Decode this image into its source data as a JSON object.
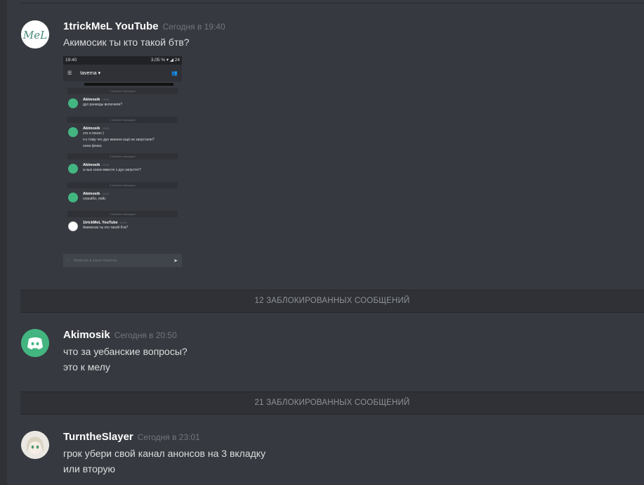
{
  "messages": [
    {
      "author": "1trickMeL YouTube",
      "timestamp": "Сегодня в 19:40",
      "avatar_text": "MeL",
      "lines": [
        "Акимосик ты кто такой бтв?"
      ]
    },
    {
      "author": "Akimosik",
      "timestamp": "Сегодня в 20:50",
      "lines": [
        "что за уебанские вопросы?",
        "это к мелу"
      ]
    },
    {
      "author": "TurntheSlayer",
      "timestamp": "Сегодня в 23:01",
      "lines": [
        "грок убери свой канал анонсов на 3 вкладку",
        "или вторую"
      ]
    }
  ],
  "blocked": [
    "12 ЗАБЛОКИРОВАННЫХ СООБЩЕНИЙ",
    "21 ЗАБЛОКИРОВАННЫХ СООБЩЕНИЙ"
  ],
  "screenshot": {
    "status_time": "19:40",
    "status_right": "3,05 % ▾ ◢ 24",
    "channel": "taverna ▾",
    "blocked_2": "2 blocked messages",
    "blocked_1": "1 blocked messages",
    "blocked_4": "4 blocked messages",
    "blocked_3": "3 blocked messages",
    "msgs": [
      {
        "author": "Akimosik",
        "time": "19:05",
        "lines": [
          "дуо ранкеды включили?"
        ]
      },
      {
        "author": "Akimosik",
        "time": "19:06",
        "lines": [
          "это я понял )",
          "я к тому что дуо именно ещё не запустили?",
          "онли флекс"
        ]
      },
      {
        "author": "Akimosik",
        "time": "19:10",
        "lines": [
          "а нью сезон вместе с дуо запустят?"
        ]
      },
      {
        "author": "Akimosik",
        "time": "19:20",
        "lines": [
          "спасибо, лойс"
        ]
      },
      {
        "author": "1trickMeL YouTube",
        "time": "19:40",
        "lines": [
          "Акимосик ты кто такой бтв?"
        ]
      }
    ],
    "input_placeholder": "Написать в канал #taverna"
  },
  "colors": {
    "background": "#36393f",
    "blocked_bar": "#2f3136",
    "discord_green": "#43b581",
    "username": "#ffffff",
    "timestamp": "#72767d"
  }
}
